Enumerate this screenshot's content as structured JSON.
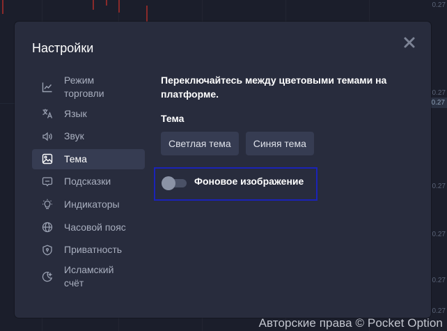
{
  "background": {
    "price_ticks": [
      "0.27",
      "0.27",
      "0.27",
      "0.27",
      "0.27",
      "0.27"
    ],
    "current_price_badge": "0.27",
    "copyright": "Авторские права © Pocket Option"
  },
  "modal": {
    "title": "Настройки",
    "close_icon": "close-icon",
    "nav": [
      {
        "label": "Режим торговли",
        "icon": "chart-line-icon",
        "active": false
      },
      {
        "label": "Язык",
        "icon": "translate-icon",
        "active": false
      },
      {
        "label": "Звук",
        "icon": "speaker-icon",
        "active": false
      },
      {
        "label": "Тема",
        "icon": "image-icon",
        "active": true
      },
      {
        "label": "Подсказки",
        "icon": "tooltip-icon",
        "active": false
      },
      {
        "label": "Индикаторы",
        "icon": "lightbulb-icon",
        "active": false
      },
      {
        "label": "Часовой пояс",
        "icon": "globe-icon",
        "active": false
      },
      {
        "label": "Приватность",
        "icon": "shield-icon",
        "active": false
      },
      {
        "label": "Исламский счёт",
        "icon": "crescent-moon-icon",
        "active": false
      }
    ],
    "content": {
      "description": "Переключайтесь между цветовыми темами на платформе.",
      "theme_label": "Тема",
      "theme_buttons": [
        "Светлая тема",
        "Синяя тема"
      ],
      "background_toggle": {
        "label": "Фоновое изображение",
        "enabled": false
      }
    }
  },
  "colors": {
    "page_bg": "#1b1e2b",
    "modal_bg": "#282c3d",
    "active_item_bg": "#363c52",
    "focus_outline": "#1a23b8"
  }
}
